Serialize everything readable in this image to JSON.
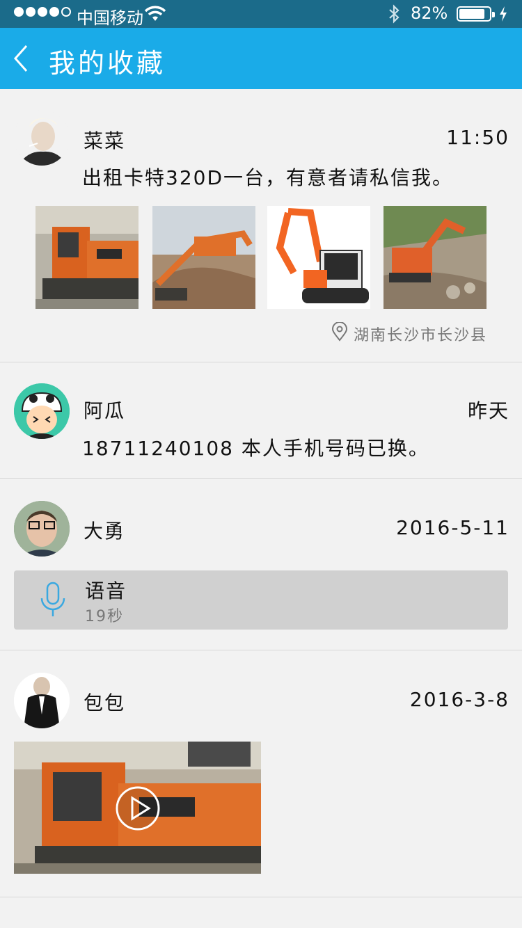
{
  "status_bar": {
    "carrier": "中国移动",
    "battery_percent": "82%",
    "signal_bars": 4,
    "signal_total": 5
  },
  "nav": {
    "title": "我的收藏",
    "back_icon": "chevron-left-icon"
  },
  "colors": {
    "status_bar_bg": "#1b6b8a",
    "nav_bg": "#1aabe8",
    "mic_icon": "#3aa8e0"
  },
  "items": [
    {
      "name": "菜菜",
      "time": "11:50",
      "text": "出租卡特320D一台，有意者请私信我。",
      "location": "湖南长沙市长沙县",
      "images": 4
    },
    {
      "name": "阿瓜",
      "time": "昨天",
      "text": "18711240108 本人手机号码已换。"
    },
    {
      "name": "大勇",
      "time": "2016-5-11",
      "voice_label": "语音",
      "voice_duration": "19秒"
    },
    {
      "name": "包包",
      "time": "2016-3-8",
      "video": true
    }
  ]
}
